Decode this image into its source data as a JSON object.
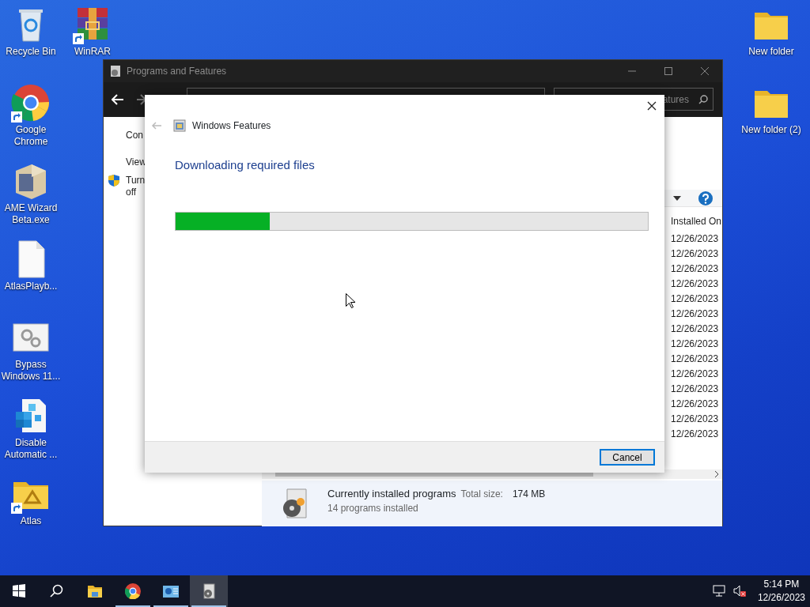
{
  "desktop": {
    "left_column": [
      {
        "label": "Recycle Bin",
        "kind": "recycle",
        "shortcut": false
      },
      {
        "label": "Google Chrome",
        "kind": "chrome",
        "shortcut": true
      },
      {
        "label": "AME Wizard Beta.exe",
        "kind": "box",
        "shortcut": false
      },
      {
        "label": "AtlasPlayb...",
        "kind": "file",
        "shortcut": false
      },
      {
        "label": "Bypass Windows 11...",
        "kind": "gears",
        "shortcut": false
      },
      {
        "label": "Disable Automatic ...",
        "kind": "cubes",
        "shortcut": false
      },
      {
        "label": "Atlas",
        "kind": "atlas",
        "shortcut": true
      }
    ],
    "second_column": [
      {
        "label": "WinRAR",
        "kind": "winrar",
        "shortcut": true
      }
    ],
    "right_column": [
      {
        "label": "New folder",
        "kind": "folder",
        "shortcut": false
      },
      {
        "label": "New folder (2)",
        "kind": "folder",
        "shortcut": false
      }
    ]
  },
  "programs_window": {
    "title": "Programs and Features",
    "search_placeholder": "atures",
    "left_pane": [
      "Con",
      "View",
      "Turn off"
    ],
    "column": "Installed On",
    "rows": [
      "12/26/2023",
      "12/26/2023",
      "12/26/2023",
      "12/26/2023",
      "12/26/2023",
      "12/26/2023",
      "12/26/2023",
      "12/26/2023",
      "12/26/2023",
      "12/26/2023",
      "12/26/2023",
      "12/26/2023",
      "12/26/2023",
      "12/26/2023"
    ],
    "details": {
      "title": "Currently installed programs",
      "size_label": "Total size:",
      "size": "174 MB",
      "count": "14 programs installed"
    }
  },
  "dialog": {
    "title": "Windows Features",
    "heading": "Downloading required files",
    "level": 0.2,
    "button": "Cancel"
  },
  "taskbar": {
    "items": [
      {
        "kind": "start",
        "running": false,
        "selected": false
      },
      {
        "kind": "search",
        "running": false,
        "selected": false
      },
      {
        "kind": "explorer",
        "running": false,
        "selected": false
      },
      {
        "kind": "chrome",
        "running": true,
        "selected": false
      },
      {
        "kind": "control",
        "running": true,
        "selected": false
      },
      {
        "kind": "programs",
        "running": true,
        "selected": true
      }
    ],
    "volume_muted": true,
    "time": "5:14 PM",
    "date": "12/26/2023"
  }
}
